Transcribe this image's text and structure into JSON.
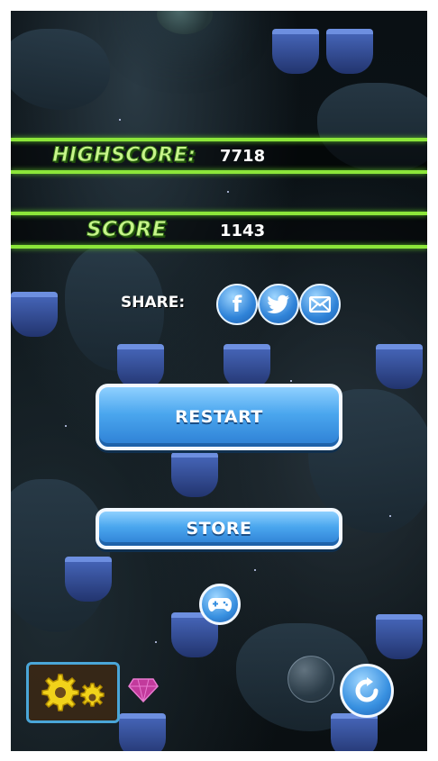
{
  "scores": {
    "highscore_label": "HIGHSCORE:",
    "highscore_value": "7718",
    "score_label": "SCORE",
    "score_value": "1143"
  },
  "share": {
    "label": "SHARE:",
    "facebook_glyph": "f",
    "icons": [
      "facebook-icon",
      "twitter-icon",
      "email-icon"
    ]
  },
  "buttons": {
    "restart": "RESTART",
    "store": "STORE"
  },
  "icons": {
    "controller": "gamepad-icon",
    "settings": "gears-icon",
    "refresh": "refresh-icon"
  },
  "colors": {
    "accent_green": "#8ce63a",
    "button_blue": "#4aa6ee",
    "label_green": "#c7f58a"
  }
}
